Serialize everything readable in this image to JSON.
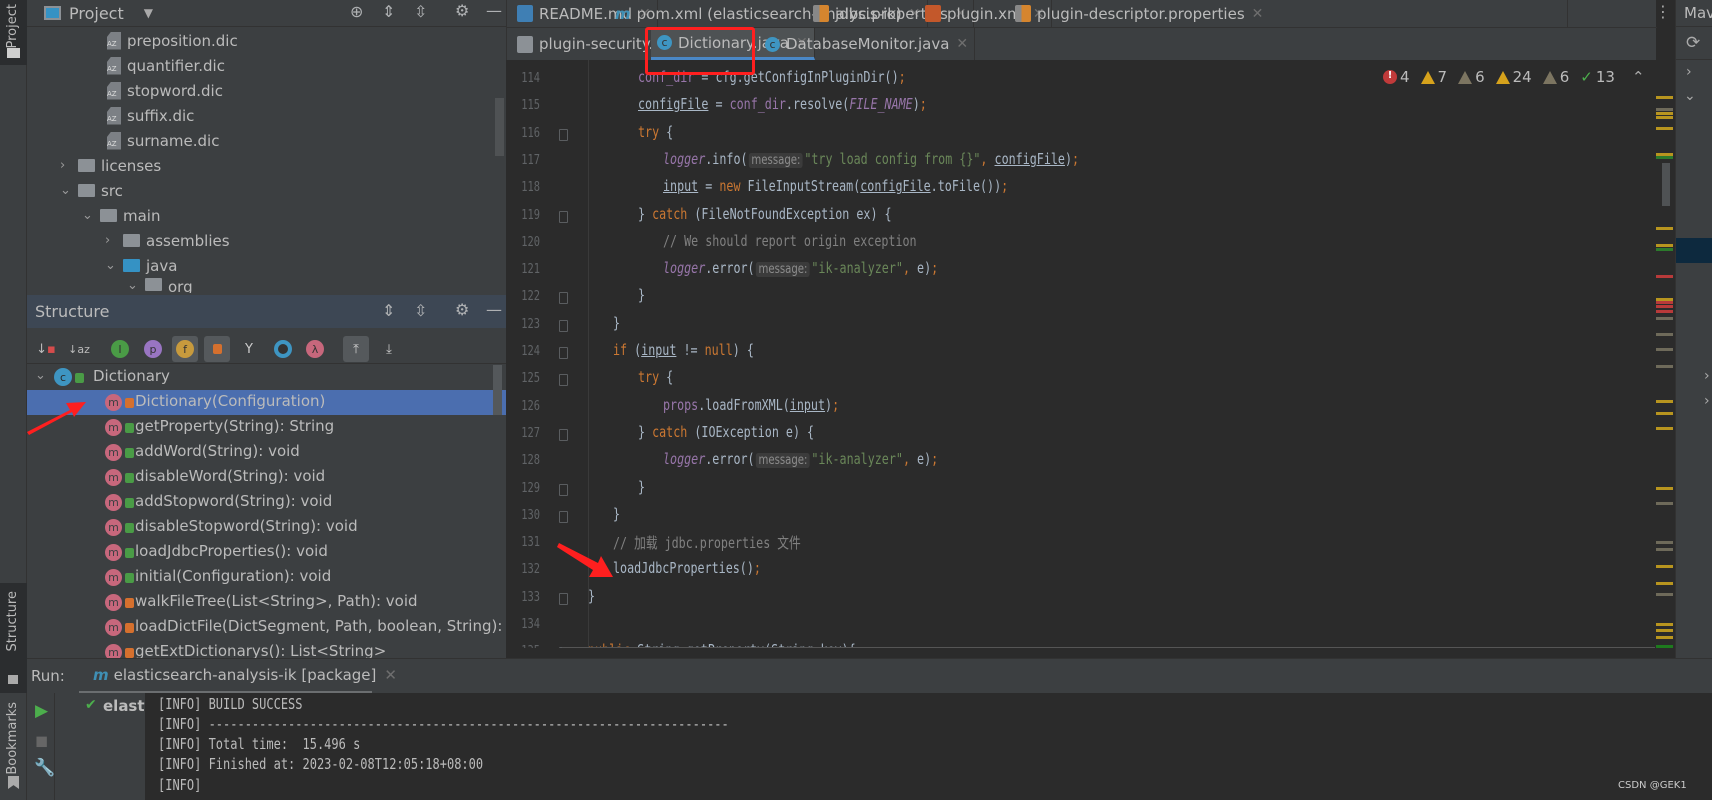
{
  "left_strip": {
    "project_label": "Project",
    "structure_label": "Structure",
    "bookmarks_label": "Bookmarks"
  },
  "project": {
    "title": "Project",
    "tree": [
      {
        "label": "preposition.dic",
        "type": "dic"
      },
      {
        "label": "quantifier.dic",
        "type": "dic"
      },
      {
        "label": "stopword.dic",
        "type": "dic"
      },
      {
        "label": "suffix.dic",
        "type": "dic"
      },
      {
        "label": "surname.dic",
        "type": "dic"
      },
      {
        "label": "licenses",
        "type": "folder",
        "expanded": false
      },
      {
        "label": "src",
        "type": "folder",
        "expanded": true
      },
      {
        "label": "main",
        "type": "folder",
        "expanded": true
      },
      {
        "label": "assemblies",
        "type": "folder",
        "expanded": false
      },
      {
        "label": "java",
        "type": "source-folder",
        "expanded": true
      },
      {
        "label": "org",
        "type": "package",
        "expanded": true
      }
    ]
  },
  "structure": {
    "title": "Structure",
    "toolbar": [
      "sort-by-visibility",
      "sort-alphabetically",
      "show-inherited",
      "show-properties",
      "show-fields",
      "show-non-public",
      "show-anonymous",
      "show-lambdas",
      "show-lambdas-2",
      "autoscroll-to-source",
      "autoscroll-from-source"
    ],
    "class_name": "Dictionary",
    "selected_index": 0,
    "members": [
      {
        "label": "Dictionary(Configuration)",
        "visibility": "private"
      },
      {
        "label": "getProperty(String): String",
        "visibility": "public"
      },
      {
        "label": "addWord(String): void",
        "visibility": "public"
      },
      {
        "label": "disableWord(String): void",
        "visibility": "public"
      },
      {
        "label": "addStopword(String): void",
        "visibility": "public"
      },
      {
        "label": "disableStopword(String): void",
        "visibility": "public"
      },
      {
        "label": "loadJdbcProperties(): void",
        "visibility": "public"
      },
      {
        "label": "initial(Configuration): void",
        "visibility": "public"
      },
      {
        "label": "walkFileTree(List<String>, Path): void",
        "visibility": "private"
      },
      {
        "label": "loadDictFile(DictSegment, Path, boolean, String): void",
        "visibility": "private"
      },
      {
        "label": "getExtDictionarys(): List<String>",
        "visibility": "private"
      }
    ]
  },
  "editor": {
    "tabs_row1": [
      {
        "label": "README.md",
        "icon": "markdown-icon"
      },
      {
        "label": "pom.xml (elasticsearch-analysis-ik)",
        "icon": "maven-icon"
      },
      {
        "label": "jdbc.properties",
        "icon": "properties-icon"
      },
      {
        "label": "plugin.xml",
        "icon": "xml-icon"
      },
      {
        "label": "plugin-descriptor.properties",
        "icon": "properties-icon"
      }
    ],
    "tabs_row2": [
      {
        "label": "plugin-security.policy",
        "icon": "text-file-icon"
      },
      {
        "label": "Dictionary.java",
        "icon": "class-icon",
        "active": true
      },
      {
        "label": "DatabaseMonitor.java",
        "icon": "class-icon"
      }
    ],
    "inspections": {
      "errors": "4",
      "warnings": "7",
      "weak_warnings": "6",
      "warnings2": "24",
      "weak_warnings2": "6",
      "typos": "13"
    },
    "code_lines": [
      {
        "n": "114",
        "indent": 2,
        "t": [
          [
            "conf_dir",
            "fld"
          ],
          [
            " = cfg.getConfigInPluginDir()",
            ""
          ],
          [
            ";",
            "kw"
          ]
        ]
      },
      {
        "n": "115",
        "indent": 2,
        "t": [
          [
            "configFile",
            "ul"
          ],
          [
            " = ",
            ""
          ],
          [
            "conf_dir",
            "fld"
          ],
          [
            ".resolve(",
            ""
          ],
          [
            "FILE_NAME",
            "ci"
          ],
          [
            ")",
            ""
          ],
          [
            ";",
            "kw"
          ]
        ]
      },
      {
        "n": "116",
        "indent": 2,
        "t": [
          [
            "try",
            "kw"
          ],
          [
            " {",
            ""
          ]
        ]
      },
      {
        "n": "117",
        "indent": 3,
        "t": [
          [
            "logger",
            "fldi"
          ],
          [
            ".info(",
            ""
          ],
          [
            "message:",
            "hint"
          ],
          [
            "\"try load config from {}\"",
            "str"
          ],
          [
            ", ",
            "kw"
          ],
          [
            "configFile",
            "ul"
          ],
          [
            ")",
            ""
          ],
          [
            ";",
            "kw"
          ]
        ]
      },
      {
        "n": "118",
        "indent": 3,
        "t": [
          [
            "input",
            "ul"
          ],
          [
            " = ",
            ""
          ],
          [
            "new ",
            "kw"
          ],
          [
            "FileInputStream(",
            ""
          ],
          [
            "configFile",
            "ul"
          ],
          [
            ".toFile())",
            ""
          ],
          [
            ";",
            "kw"
          ]
        ]
      },
      {
        "n": "119",
        "indent": 2,
        "t": [
          [
            "} ",
            ""
          ],
          [
            "catch",
            "kw"
          ],
          [
            " (FileNotFoundException ex) {",
            ""
          ]
        ]
      },
      {
        "n": "120",
        "indent": 3,
        "t": [
          [
            "// We should report origin exception",
            "cm"
          ]
        ]
      },
      {
        "n": "121",
        "indent": 3,
        "t": [
          [
            "logger",
            "fldi"
          ],
          [
            ".error(",
            ""
          ],
          [
            "message:",
            "hint"
          ],
          [
            "\"ik-analyzer\"",
            "str"
          ],
          [
            ", ",
            "kw"
          ],
          [
            "e)",
            ""
          ],
          [
            ";",
            "kw"
          ]
        ]
      },
      {
        "n": "122",
        "indent": 2,
        "t": [
          [
            "}",
            ""
          ]
        ]
      },
      {
        "n": "123",
        "indent": 1,
        "t": [
          [
            "}",
            ""
          ]
        ]
      },
      {
        "n": "124",
        "indent": 1,
        "t": [
          [
            "if",
            "kw"
          ],
          [
            " (",
            ""
          ],
          [
            "input",
            "ul"
          ],
          [
            " != ",
            ""
          ],
          [
            "null",
            "kw"
          ],
          [
            ") {",
            ""
          ]
        ]
      },
      {
        "n": "125",
        "indent": 2,
        "t": [
          [
            "try",
            "kw"
          ],
          [
            " {",
            ""
          ]
        ]
      },
      {
        "n": "126",
        "indent": 3,
        "t": [
          [
            "props",
            "fld"
          ],
          [
            ".loadFromXML(",
            ""
          ],
          [
            "input",
            "ul"
          ],
          [
            ")",
            ""
          ],
          [
            ";",
            "kw"
          ]
        ]
      },
      {
        "n": "127",
        "indent": 2,
        "t": [
          [
            "} ",
            ""
          ],
          [
            "catch",
            "kw"
          ],
          [
            " (IOException e) {",
            ""
          ]
        ]
      },
      {
        "n": "128",
        "indent": 3,
        "t": [
          [
            "logger",
            "fldi"
          ],
          [
            ".error(",
            ""
          ],
          [
            "message:",
            "hint"
          ],
          [
            "\"ik-analyzer\"",
            "str"
          ],
          [
            ", ",
            "kw"
          ],
          [
            "e)",
            ""
          ],
          [
            ";",
            "kw"
          ]
        ]
      },
      {
        "n": "129",
        "indent": 2,
        "t": [
          [
            "}",
            ""
          ]
        ]
      },
      {
        "n": "130",
        "indent": 1,
        "t": [
          [
            "}",
            ""
          ]
        ]
      },
      {
        "n": "131",
        "indent": 1,
        "t": [
          [
            "// 加载 jdbc.properties 文件",
            "cm"
          ]
        ]
      },
      {
        "n": "132",
        "indent": 1,
        "t": [
          [
            "loadJdbcProperties()",
            ""
          ],
          [
            ";",
            "kw"
          ]
        ]
      },
      {
        "n": "133",
        "indent": 0,
        "t": [
          [
            "}",
            ""
          ]
        ]
      },
      {
        "n": "134",
        "indent": 0,
        "t": []
      },
      {
        "n": "135",
        "indent": 0,
        "t": [
          [
            "public ",
            "kw"
          ],
          [
            "String ",
            ""
          ],
          [
            "getProperty(String key){",
            ""
          ]
        ]
      }
    ]
  },
  "maven": {
    "title": "Maven"
  },
  "run": {
    "label": "Run:",
    "tab_label": "elasticsearch-analysis-ik [package]",
    "tree_item": "elastic",
    "console": [
      "[INFO] BUILD SUCCESS",
      "[INFO] ------------------------------------------------------------------------",
      "[INFO] Total time:  15.496 s",
      "[INFO] Finished at: 2023-02-08T12:05:18+08:00",
      "[INFO] "
    ]
  },
  "watermark": "CSDN @GEK1",
  "colors": {
    "keyword": "#cc7832",
    "string": "#6a8759",
    "field": "#9876aa",
    "comment": "#808080",
    "selection": "#4b6eaf",
    "annotation": "#ff1f1f"
  }
}
